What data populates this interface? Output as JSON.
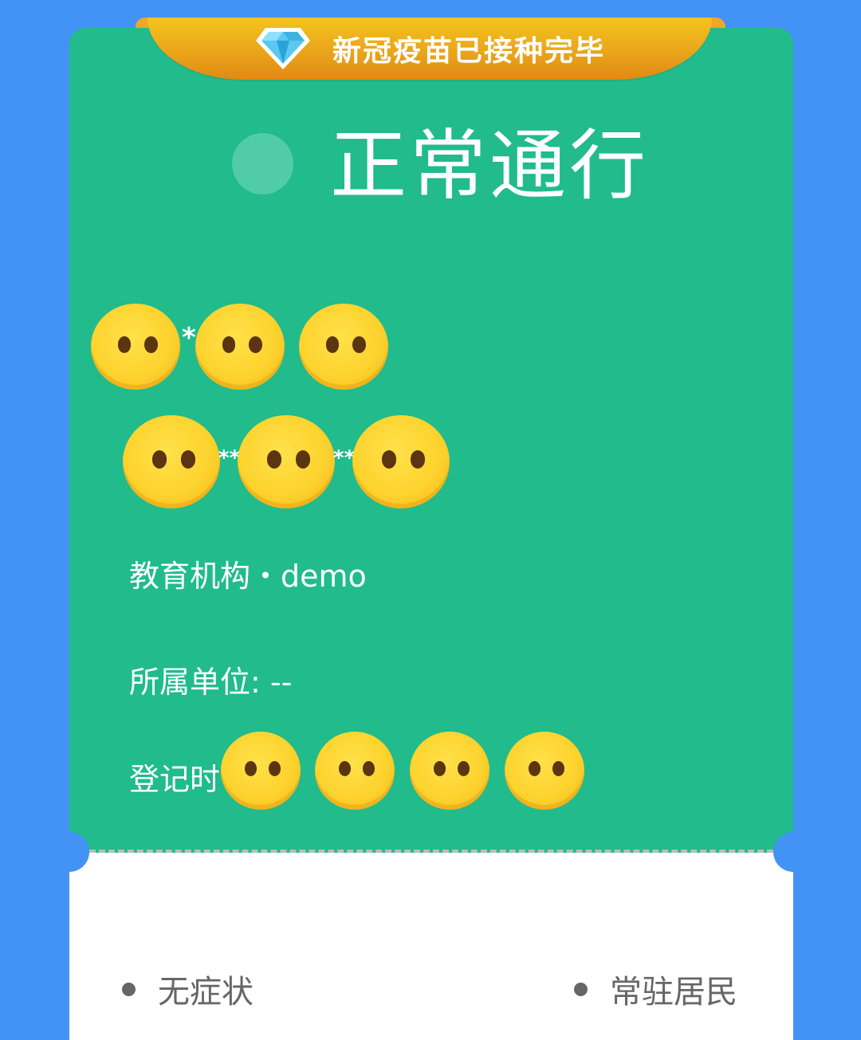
{
  "banner": {
    "text": "新冠疫苗已接种完毕",
    "icon": "diamond-icon"
  },
  "status": {
    "text": "正常通行",
    "indicator_color": "#50cda8"
  },
  "masked_name": {
    "separators": [
      "*"
    ]
  },
  "masked_id": {
    "separators": [
      "**",
      "**"
    ]
  },
  "info": {
    "organization": "教育机构・demo",
    "unit": "所属单位: --",
    "register_label": "登记时"
  },
  "tags": {
    "left": "无症状",
    "right": "常驻居民"
  },
  "colors": {
    "background": "#4392f5",
    "card_green": "#21bb8c",
    "banner_gold": "#eaa21a"
  }
}
